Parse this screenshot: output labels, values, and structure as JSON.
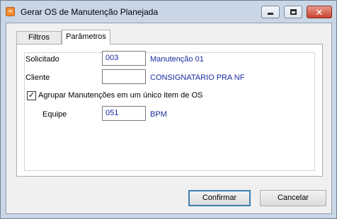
{
  "window": {
    "title": "Gerar OS de Manutenção Planejada",
    "app_icon_glyph": "♒",
    "controls": {
      "minimize": "minimize-icon",
      "maximize": "maximize-icon",
      "close": "close-icon"
    }
  },
  "tabs": [
    {
      "label": "Filtros",
      "active": false
    },
    {
      "label": "Parâmetros",
      "active": true
    }
  ],
  "form": {
    "solicitado": {
      "label": "Solicitado",
      "value": "003",
      "description": "Manutenção 01"
    },
    "cliente": {
      "label": "Cliente",
      "value": "",
      "description": "CONSIGNATARIO PRA NF"
    },
    "agrupar": {
      "label": "Agrupar Manutenções em um único item de OS",
      "checked": true,
      "check_glyph": "✓"
    },
    "equipe": {
      "label": "Equipe",
      "value": "051",
      "description": "BPM"
    }
  },
  "buttons": {
    "confirm": "Confirmar",
    "cancel": "Cancelar"
  },
  "colors": {
    "value_text": "#1a2aa0",
    "title_bar": "#c9d6e6",
    "default_button_border": "#3c7fb1"
  }
}
